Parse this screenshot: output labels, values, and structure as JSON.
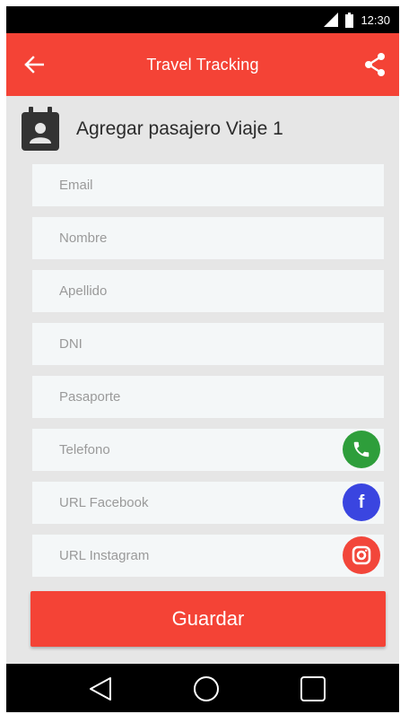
{
  "status_bar": {
    "time": "12:30"
  },
  "app_bar": {
    "title": "Travel Tracking",
    "back_icon": "arrow-left-icon",
    "share_icon": "share-icon"
  },
  "section": {
    "icon": "calendar-person-icon",
    "heading": "Agregar pasajero Viaje 1"
  },
  "form": {
    "email_placeholder": "Email",
    "nombre_placeholder": "Nombre",
    "apellido_placeholder": "Apellido",
    "dni_placeholder": "DNI",
    "pasaporte_placeholder": "Pasaporte",
    "telefono_placeholder": "Telefono",
    "facebook_placeholder": "URL Facebook",
    "instagram_placeholder": "URL Instagram",
    "facebook_glyph": "f"
  },
  "actions": {
    "save_label": "Guardar"
  },
  "colors": {
    "primary": "#f44336",
    "phone": "#2e9e3b",
    "facebook": "#3a45e0",
    "instagram": "#f2463a"
  }
}
